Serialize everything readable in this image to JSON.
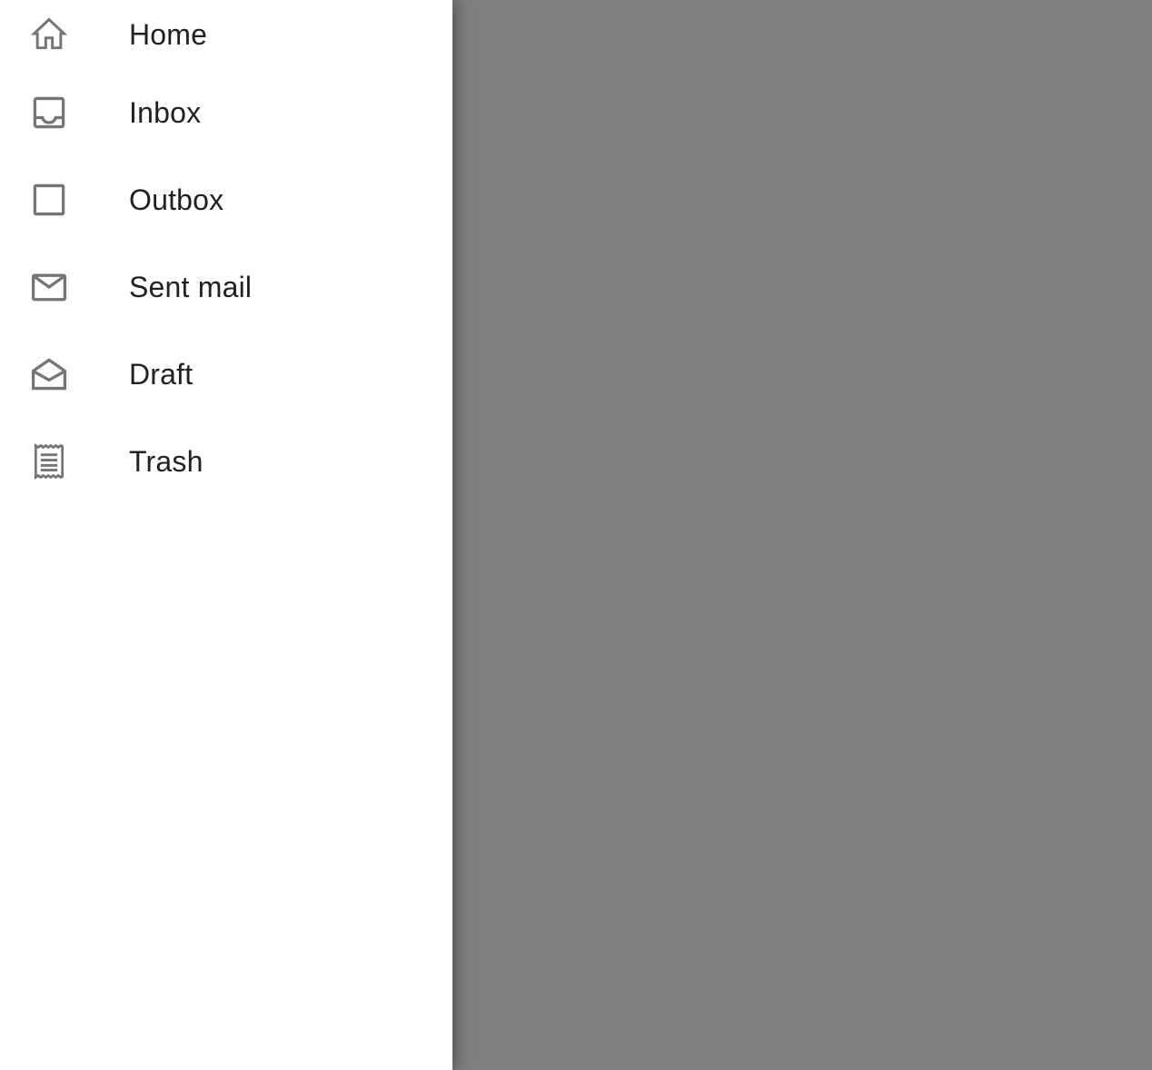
{
  "drawer": {
    "items": [
      {
        "label": "Home",
        "icon": "home-icon"
      },
      {
        "label": "Inbox",
        "icon": "inbox-icon"
      },
      {
        "label": "Outbox",
        "icon": "outbox-icon"
      },
      {
        "label": "Sent mail",
        "icon": "mail-icon"
      },
      {
        "label": "Draft",
        "icon": "drafts-icon"
      },
      {
        "label": "Trash",
        "icon": "receipt-icon"
      }
    ]
  },
  "colors": {
    "drawer_background": "#ffffff",
    "scrim": "#7f7f7f",
    "icon": "#757575",
    "label_text": "#212121"
  }
}
